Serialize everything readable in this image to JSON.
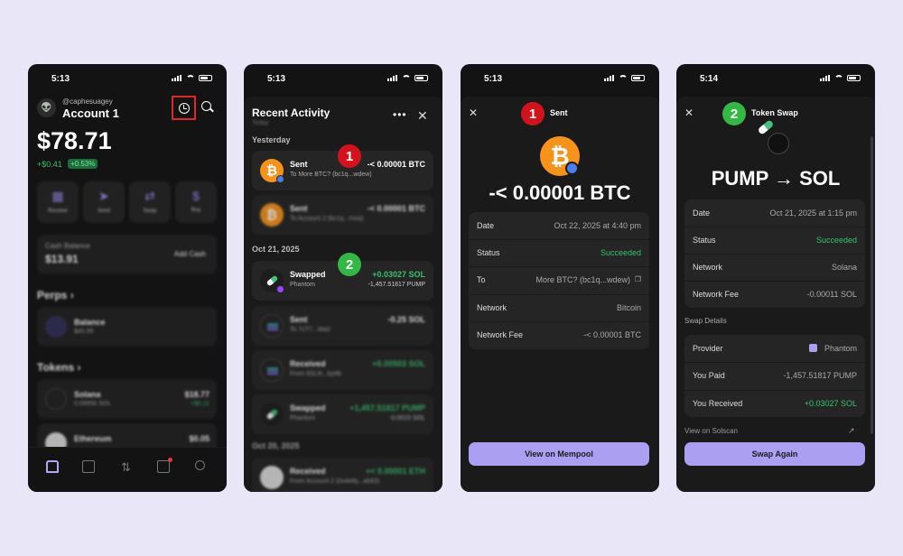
{
  "screen1": {
    "time": "5:13",
    "handle": "@caphesuagey",
    "account": "Account 1",
    "balance": "$78.71",
    "change": "+$0.41",
    "change_pct": "+0.53%",
    "actions": [
      {
        "label": "Receive"
      },
      {
        "label": "Send"
      },
      {
        "label": "Swap"
      },
      {
        "label": "Buy"
      }
    ],
    "cash": {
      "title": "Cash Balance",
      "value": "$13.91",
      "button": "Add Cash"
    },
    "perps_header": "Perps",
    "perps_row": {
      "name": "Balance",
      "sub": "$45.99"
    },
    "tokens_header": "Tokens",
    "tokens": [
      {
        "name": "Solana",
        "sub": "0.09956 SOL",
        "value": "$18.77",
        "change": "+$0.11"
      },
      {
        "name": "Ethereum",
        "sub": "",
        "value": "$0.05",
        "change": ""
      }
    ]
  },
  "screen2": {
    "time": "5:13",
    "title": "Recent Activity",
    "subtitle": "Today",
    "group1": "Yesterday",
    "group2": "Oct 21, 2025",
    "group3": "Oct 20, 2025",
    "rows": [
      {
        "name": "Sent",
        "sub": "To More BTC? (bc1q...wdew)",
        "amount": "-< 0.00001 BTC",
        "amount2": ""
      },
      {
        "name": "Sent",
        "sub": "To Account 2 (bc1q...rnsa)",
        "amount": "-< 0.00001 BTC",
        "amount2": ""
      },
      {
        "name": "Swapped",
        "sub": "Phantom",
        "amount": "+0.03027 SOL",
        "amount2": "-1,457.51817 PUMP"
      },
      {
        "name": "Sent",
        "sub": "To 7cT7...Wa2",
        "amount": "-0.25 SOL",
        "amount2": ""
      },
      {
        "name": "Received",
        "sub": "From 6SLR...byttb",
        "amount": "+0.00503 SOL",
        "amount2": ""
      },
      {
        "name": "Swapped",
        "sub": "Phantom",
        "amount": "+1,457.51817 PUMP",
        "amount2": "-0.0015 SOL"
      },
      {
        "name": "Received",
        "sub": "From Account 2 (0x4e8y...ab83)",
        "amount": "+< 0.00001 ETH",
        "amount2": ""
      }
    ],
    "badges": [
      "1",
      "2"
    ]
  },
  "screen3": {
    "time": "5:13",
    "title": "Sent",
    "badge": "1",
    "icon_letter": "₿",
    "amount": "-< 0.00001 BTC",
    "details": [
      {
        "k": "Date",
        "v": "Oct 22, 2025 at 4:40 pm"
      },
      {
        "k": "Status",
        "v": "Succeeded"
      },
      {
        "k": "To",
        "v": "More BTC? (bc1q...wdew)"
      },
      {
        "k": "Network",
        "v": "Bitcoin"
      },
      {
        "k": "Network Fee",
        "v": "-< 0.00001 BTC"
      }
    ],
    "button": "View on Mempool"
  },
  "screen4": {
    "time": "5:14",
    "title": "Token Swap",
    "badge": "2",
    "headline": "PUMP → SOL",
    "details": [
      {
        "k": "Date",
        "v": "Oct 21, 2025 at 1:15 pm"
      },
      {
        "k": "Status",
        "v": "Succeeded"
      },
      {
        "k": "Network",
        "v": "Solana"
      },
      {
        "k": "Network Fee",
        "v": "-0.00011 SOL"
      }
    ],
    "swap_header": "Swap Details",
    "swap": [
      {
        "k": "Provider",
        "v": "Phantom"
      },
      {
        "k": "You Paid",
        "v": "-1,457.51817 PUMP"
      },
      {
        "k": "You Received",
        "v": "+0.03027 SOL"
      }
    ],
    "link": "View on Solscan",
    "button": "Swap Again"
  },
  "colors": {
    "accent": "#ab9ff2",
    "success": "#35c36b",
    "badge_red": "#d3121c",
    "badge_green": "#33b843",
    "bitcoin": "#f7931a"
  }
}
